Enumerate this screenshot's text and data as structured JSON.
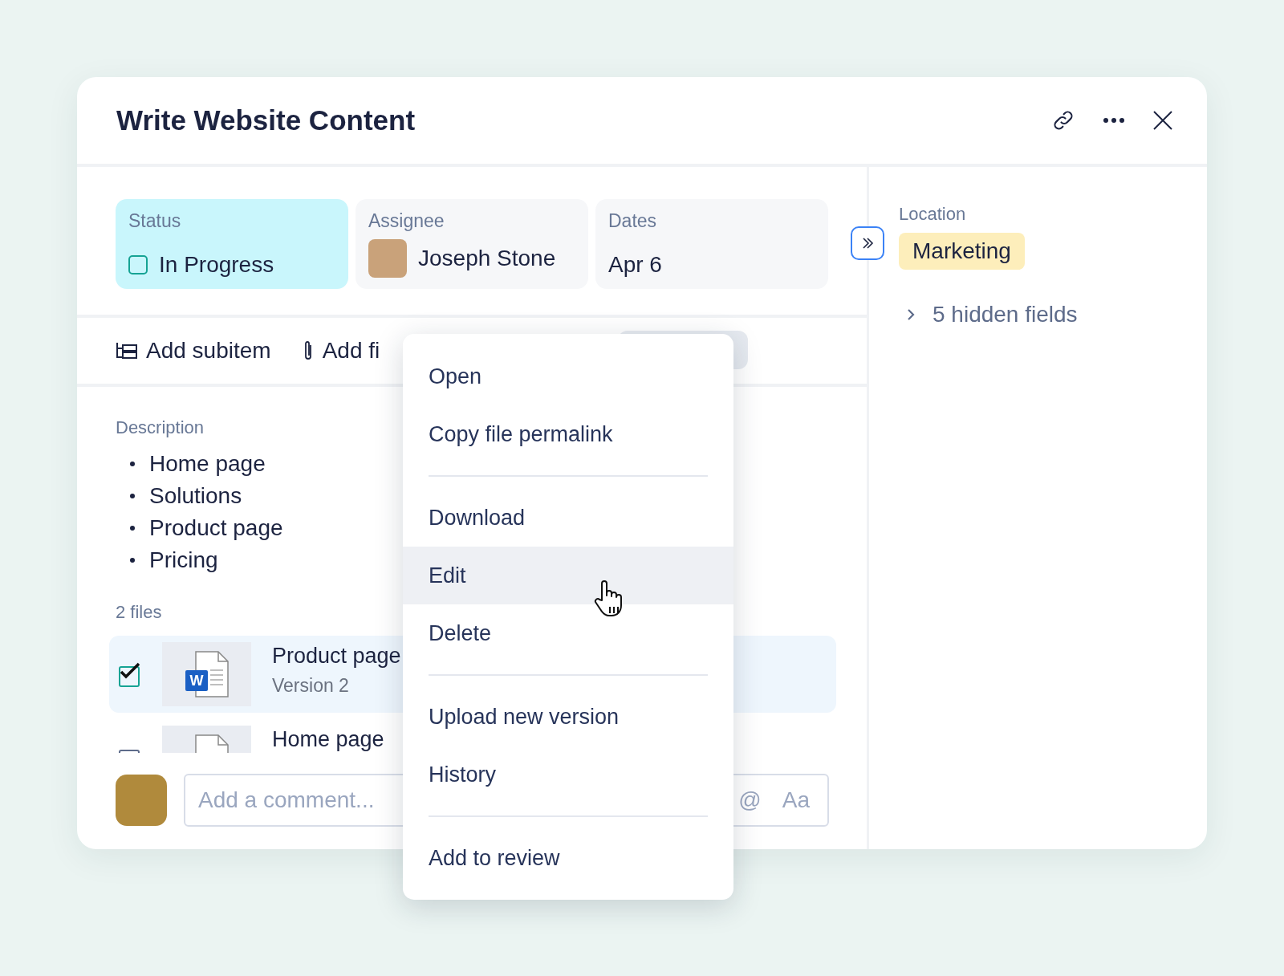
{
  "window": {
    "title": "Write Website Content"
  },
  "fields": [
    {
      "label": "Status",
      "value": "In Progress",
      "kind": "status",
      "checked": false
    },
    {
      "label": "Assignee",
      "value": "Joseph Stone",
      "kind": "person"
    },
    {
      "label": "Dates",
      "value": "Apr 6",
      "kind": "text"
    }
  ],
  "toolbar": [
    {
      "label": "Add subitem",
      "kind": "subitem"
    },
    {
      "label": "Add fi",
      "kind": "attach"
    }
  ],
  "description": {
    "label": "Description",
    "items": [
      "Home page",
      "Solutions",
      "Product page",
      "Pricing"
    ]
  },
  "files": {
    "count": "2 files",
    "items": [
      {
        "name": "Product page",
        "version": "Version 2",
        "badge": "W",
        "checked": true,
        "selected": true
      },
      {
        "name": "Home page",
        "checked": false,
        "selected": false
      }
    ]
  },
  "comment": {
    "placeholder": "Add a comment...",
    "tools": [
      "@",
      "Aa"
    ]
  },
  "sidebar": {
    "label": "Location",
    "tag": "Marketing",
    "hidden_fields": "5 hidden fields"
  },
  "context_menu": [
    [
      {
        "label": "Open",
        "hovered": false
      },
      {
        "label": "Copy file permalink",
        "hovered": false
      }
    ],
    [
      {
        "label": "Download",
        "hovered": false
      },
      {
        "label": "Edit",
        "hovered": true
      },
      {
        "label": "Delete",
        "hovered": false
      }
    ],
    [
      {
        "label": "Upload new version",
        "hovered": false
      },
      {
        "label": "History",
        "hovered": false
      }
    ],
    [
      {
        "label": "Add to review",
        "hovered": false
      }
    ]
  ]
}
